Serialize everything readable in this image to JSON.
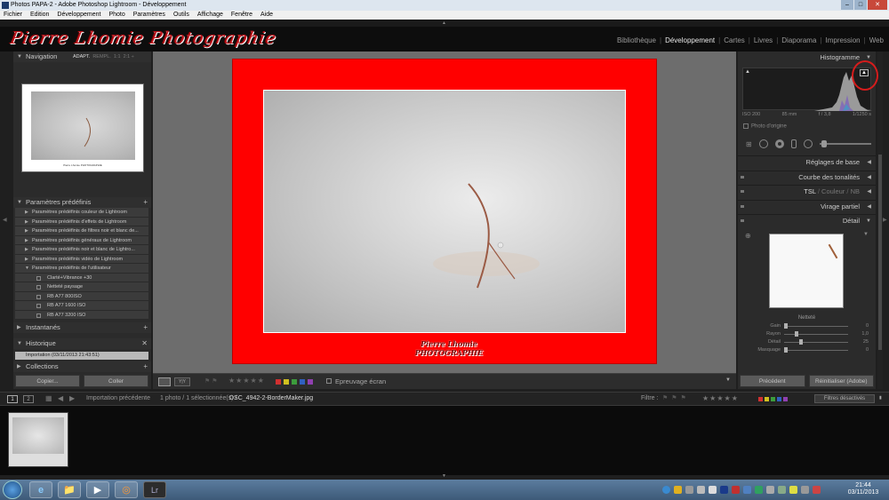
{
  "window": {
    "title": "Photos PAPA-2 - Adobe Photoshop Lightroom - Développement"
  },
  "menu": [
    "Fichier",
    "Edition",
    "Développement",
    "Photo",
    "Paramètres",
    "Outils",
    "Affichage",
    "Fenêtre",
    "Aide"
  ],
  "identity_plate": "Pierre Lhomie Photographie",
  "modules": [
    {
      "label": "Bibliothèque",
      "active": false
    },
    {
      "label": "Développement",
      "active": true
    },
    {
      "label": "Cartes",
      "active": false
    },
    {
      "label": "Livres",
      "active": false
    },
    {
      "label": "Diaporama",
      "active": false
    },
    {
      "label": "Impression",
      "active": false
    },
    {
      "label": "Web",
      "active": false
    }
  ],
  "left": {
    "navigator": {
      "title": "Navigation",
      "opt_fit": "ADAPT.",
      "opt_fill": "REMPL.",
      "opt_11": "1:1",
      "opt_21": "2:1 ÷",
      "preview_caption": "Pierre Lhomie PHOTOGRAPHIE"
    },
    "presets": {
      "title": "Paramètres prédéfinis",
      "groups": [
        "Paramètres prédéfinis couleur de Lightroom",
        "Paramètres prédéfinis d'effets de Lightroom",
        "Paramètres prédéfinis de filtres noir et blanc de...",
        "Paramètres prédéfinis généraux de Lightroom",
        "Paramètres prédéfinis noir et blanc de Lightro...",
        "Paramètres prédéfinis vidéo de Lightroom",
        "Paramètres prédéfinis de l'utilisateur"
      ],
      "user_items": [
        "Clarté+Vibrance +30",
        "Netteté paysage",
        "RB A77 800ISO",
        "RB A77 1600 ISO",
        "RB A77 3200 ISO"
      ]
    },
    "snapshots": {
      "title": "Instantanés"
    },
    "history": {
      "title": "Historique",
      "item": "Importation (03/11/2013 21:43:51)"
    },
    "collections": {
      "title": "Collections"
    },
    "copy_button": "Copier...",
    "paste_button": "Coller"
  },
  "image": {
    "signature": "Pierre Lhomie PHOTOGRAPHIE"
  },
  "toolbar": {
    "flags": "⚑ ⚑",
    "stars": "★★★★★",
    "colors": [
      "#d03030",
      "#d0c020",
      "#3c9c3c",
      "#3060c0",
      "#9040b0"
    ],
    "softproof": "Epreuvage écran"
  },
  "right": {
    "histogram": {
      "title": "Histogramme",
      "iso": "ISO 200",
      "focal": "85 mm",
      "aperture": "f / 3,8",
      "shutter": "1/1250 s",
      "original": "Photo d'origine"
    },
    "panels": [
      "Réglages de base",
      "Courbe des tonalités",
      "Virage partiel",
      "Détail"
    ],
    "hsl": {
      "a": "TSL",
      "b": "Couleur",
      "c": "NB",
      "sep": "/"
    },
    "sharpening": {
      "title": "Netteté",
      "rows": [
        {
          "label": "Gain",
          "value": "0",
          "pos": 0
        },
        {
          "label": "Rayon",
          "value": "1,0",
          "pos": 0.17
        },
        {
          "label": "Détail",
          "value": "25",
          "pos": 0.25
        },
        {
          "label": "Masquage",
          "value": "0",
          "pos": 0
        }
      ]
    },
    "prev_button": "Précédent",
    "reset_button": "Réinitialiser (Adobe)"
  },
  "filmbar": {
    "view1": "1",
    "view2": "2",
    "source": "Importation précédente",
    "count": "1 photo / 1 sélectionnée(s) /",
    "filename": "DSC_4942-2-BorderMaker.jpg",
    "filter_label": "Filtre :",
    "filter_state": "Filtres désactivés"
  },
  "taskbar": {
    "apps": [
      "e",
      "📁",
      "▶",
      "◎",
      "Lr"
    ],
    "time": "21:44",
    "date": "03/11/2013"
  }
}
